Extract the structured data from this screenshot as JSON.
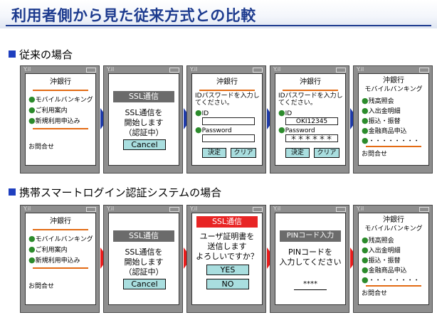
{
  "title": "利用者側から見た従来方式との比較",
  "section1": {
    "heading": "従来の場合"
  },
  "section2": {
    "heading": "携帯スマートログイン認証システムの場合"
  },
  "phone_menu": {
    "title": "沖銀行",
    "items": [
      "モバイルバンキング",
      "ご利用案内",
      "新規利用申込み"
    ],
    "footer": "お問合せ"
  },
  "phone_ssl": {
    "header": "SSL通信",
    "lines": [
      "SSL通信を",
      "開始します",
      "（認証中）"
    ],
    "cancel": "Cancel"
  },
  "phone_login_empty": {
    "title": "沖銀行",
    "prompt": [
      "IDパスワードを入力し",
      "てください。"
    ],
    "id_label": "ID",
    "password_label": "Password",
    "ok": "決定",
    "clear": "クリア"
  },
  "phone_login_filled": {
    "title": "沖銀行",
    "prompt": [
      "IDパスワードを入力し",
      "てください。"
    ],
    "id_label": "ID",
    "id_value": "OKI12345",
    "password_label": "Password",
    "password_value": "＊＊＊＊＊＊",
    "ok": "決定",
    "clear": "クリア"
  },
  "phone_bank": {
    "title": "沖銀行",
    "subtitle": "モバイルバンキング",
    "items": [
      "残高照会",
      "入出金明細",
      "振込・振替",
      "金融商品申込",
      "・・・・・・・・"
    ],
    "footer": "お問合せ"
  },
  "phone_cert": {
    "header": "SSL通信",
    "lines": [
      "ユーザ証明書を",
      "送信します",
      "よろしいですか？"
    ],
    "yes": "YES",
    "no": "NO"
  },
  "phone_pin": {
    "header": "PINコード入力",
    "lines": [
      "PINコードを",
      "入力してください"
    ],
    "pin_value": "****"
  },
  "colors": {
    "title": "#1c3a8e",
    "arrow_row1": "#1e3aa8",
    "arrow_row2": "#e81c1c",
    "accent_line": "#e36b14",
    "button": "#a9dedf"
  },
  "icons": {
    "antenna": "Y.il",
    "battery": "battery-icon"
  }
}
